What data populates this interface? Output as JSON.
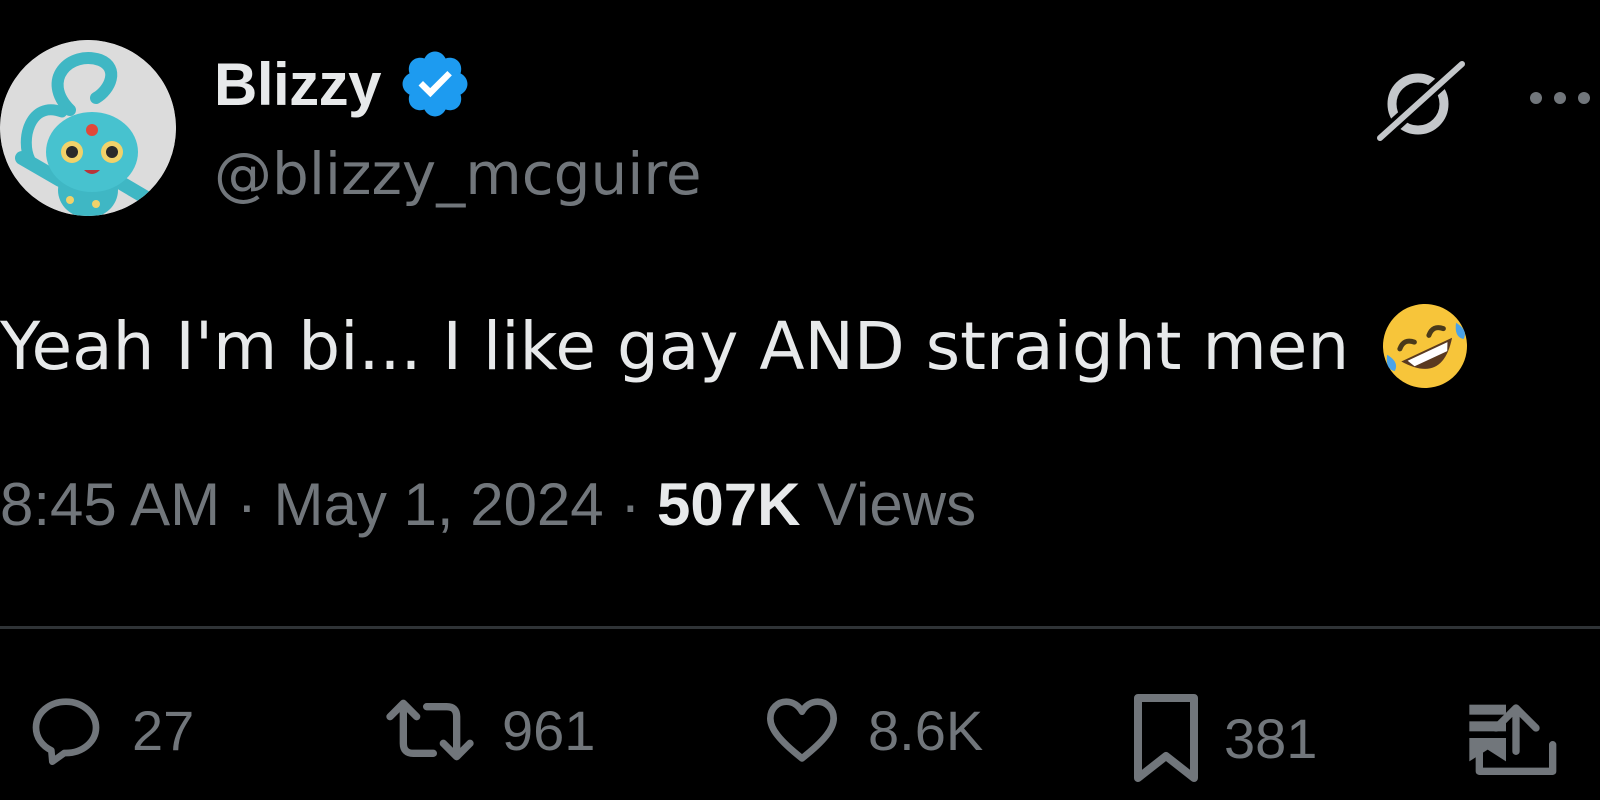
{
  "author": {
    "display_name": "Blizzy",
    "handle": "@blizzy_mcguire",
    "verified_color": "#1d9bf0",
    "avatar_icon": "manaphy-avatar"
  },
  "tweet": {
    "text": "Yeah I'm bi... I like gay AND straight men",
    "emoji": "rolling-on-floor-laughing-emoji"
  },
  "meta": {
    "time": "8:45 AM",
    "separator": "·",
    "date": "May 1, 2024",
    "views_count": "507K",
    "views_label": "Views"
  },
  "actions": {
    "replies": "27",
    "reposts": "961",
    "likes": "8.6K",
    "bookmarks": "381"
  },
  "colors": {
    "background": "#000000",
    "text": "#e7e9ea",
    "muted": "#71767b",
    "divider": "#2f3336"
  }
}
